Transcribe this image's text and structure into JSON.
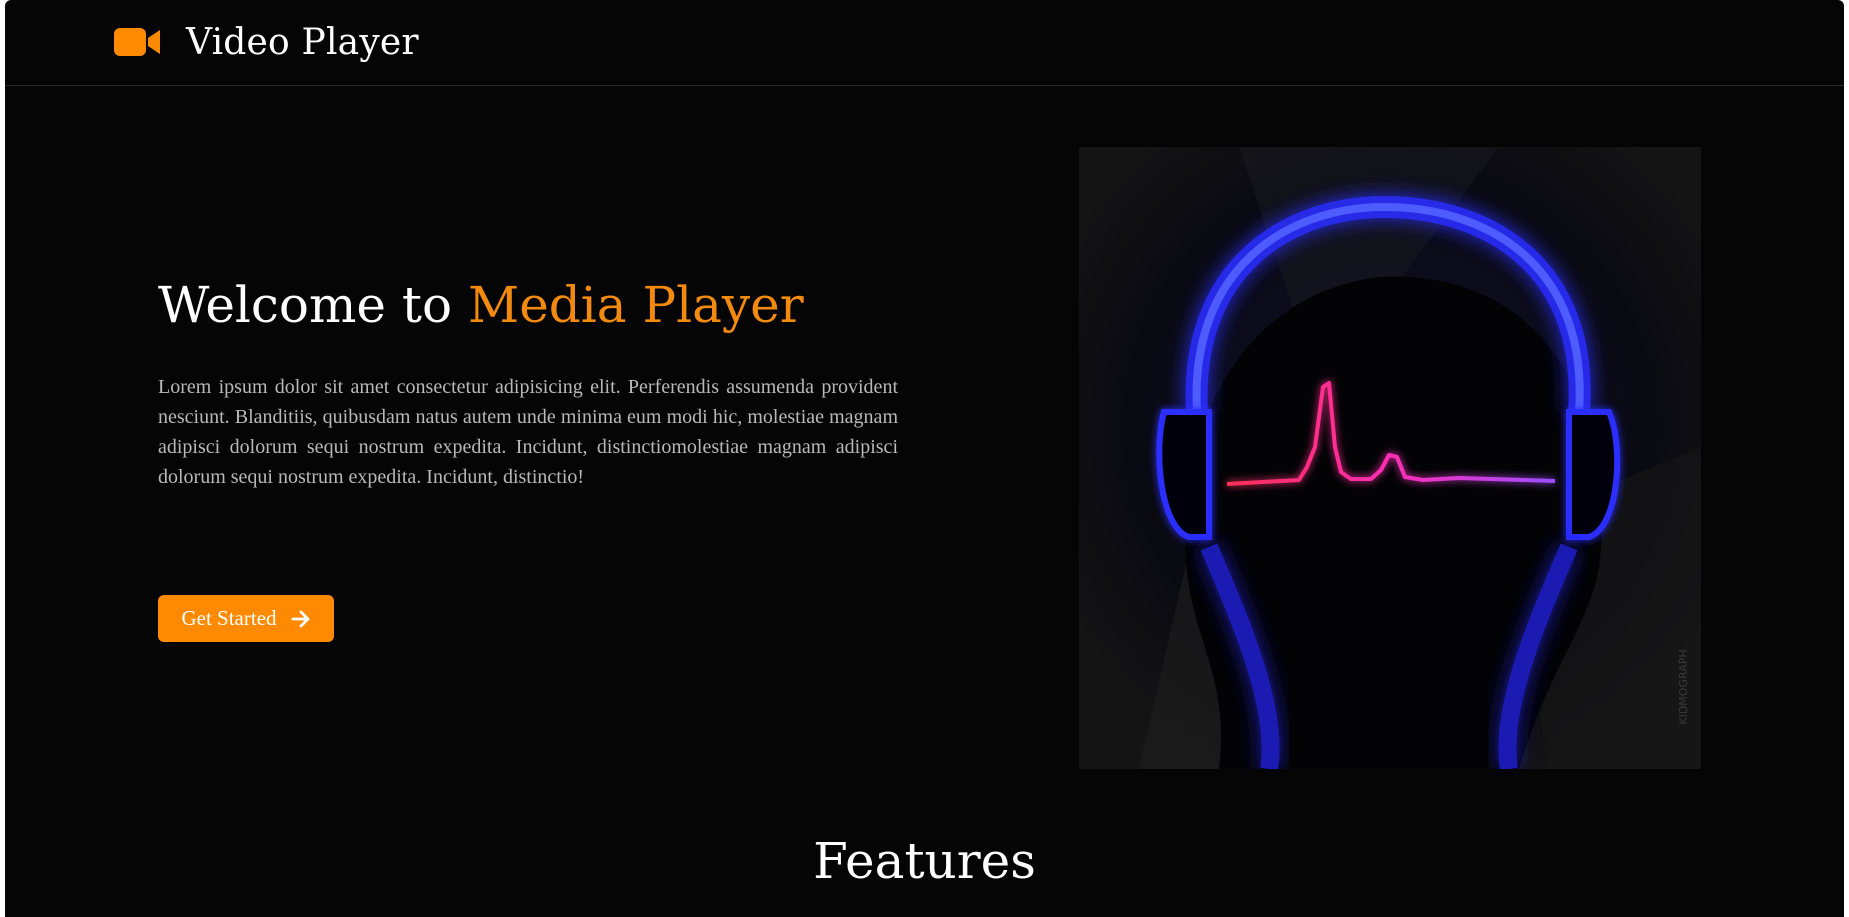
{
  "header": {
    "brand_icon": "video-camera-icon",
    "title": "Video Player"
  },
  "hero": {
    "heading_prefix": "Welcome to ",
    "heading_accent": "Media Player",
    "paragraph": "Lorem ipsum dolor sit amet consectetur adipisicing elit. Perferendis assumenda provident nesciunt. Blanditiis, quibusdam natus autem unde minima eum modi hic, molestiae magnam adipisci dolorum sequi nostrum expedita. Incidunt, distinctiomolestiae magnam adipisci dolorum sequi nostrum expedita. Incidunt, distinctio!",
    "cta_label": "Get Started",
    "cta_icon": "arrow-right-icon",
    "image": {
      "subject": "neon headphones with heartbeat line",
      "watermark": "KIDMOGRAPH"
    }
  },
  "features": {
    "title": "Features"
  },
  "colors": {
    "background": "#050505",
    "accent": "#f28a0f",
    "button": "#ff8a00",
    "text": "#ffffff",
    "muted_text": "#b9b9b9",
    "neon_blue": "#2a2cff",
    "neon_pink": "#ff2f6e"
  }
}
